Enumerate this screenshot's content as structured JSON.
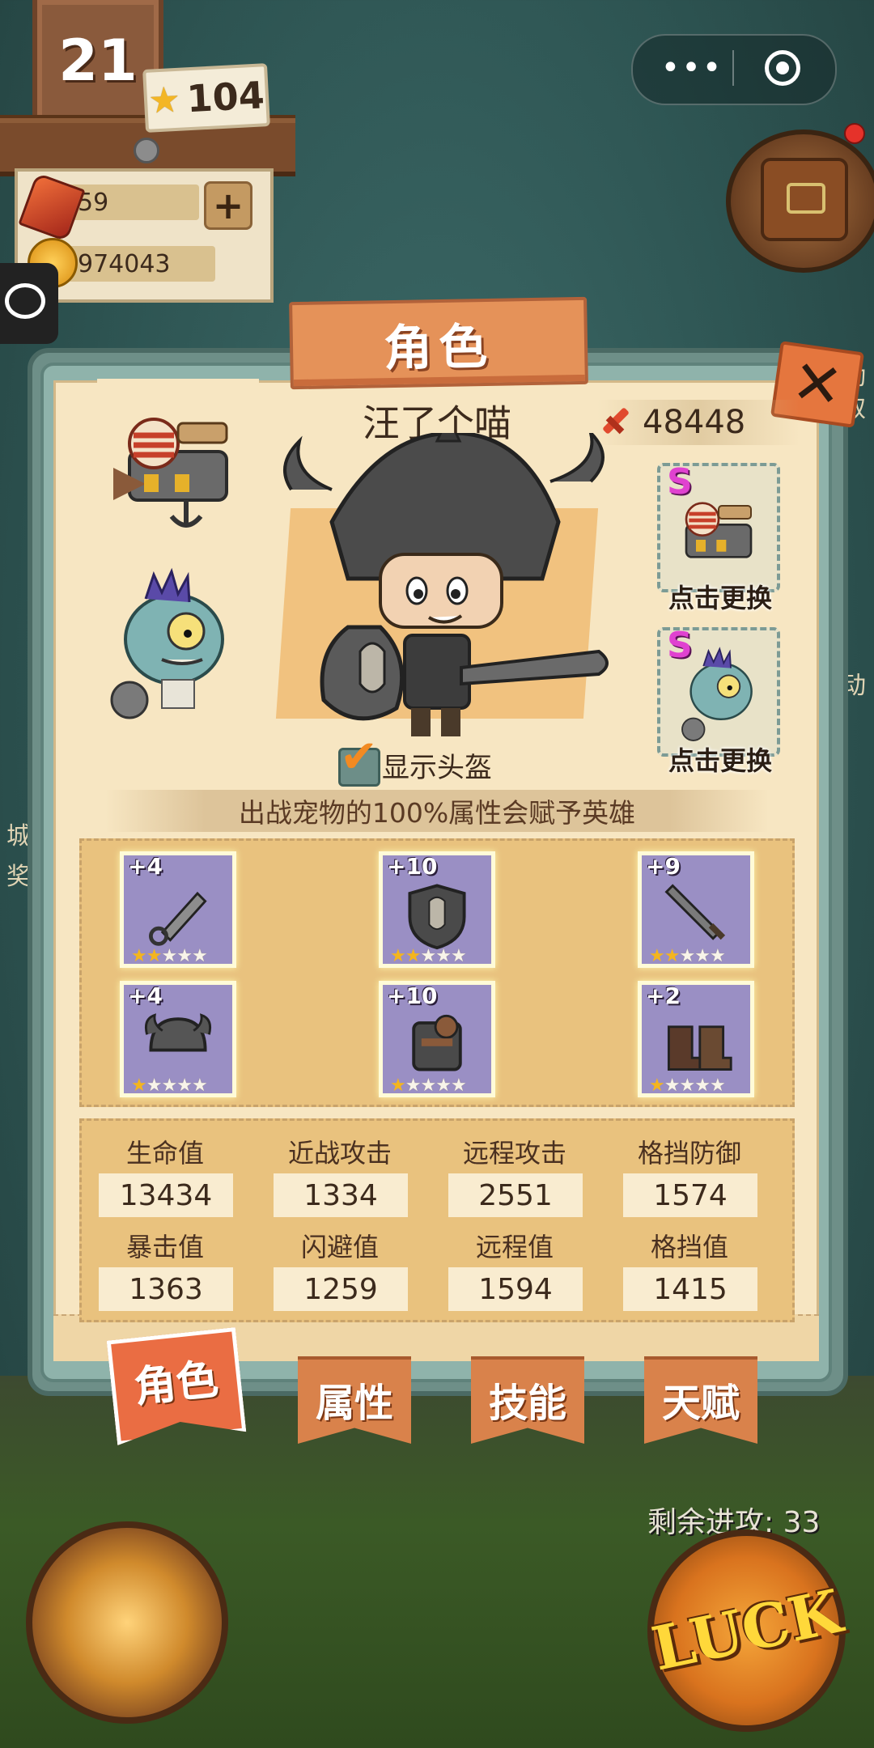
{
  "hud": {
    "level": "21",
    "stars": "104",
    "gems": "59",
    "coins": "974043",
    "add_label": "+"
  },
  "capsule": {
    "more": "•••"
  },
  "panel": {
    "title": "角色",
    "close_label": "✕",
    "hero_name": "汪了个喵",
    "power": "48448",
    "slot_badge": "S",
    "swap_label_1": "点击更换",
    "swap_label_2": "点击更换",
    "helmet_label": "显示头盔",
    "helmet_checked": true,
    "banner": "出战宠物的100%属性会赋予英雄"
  },
  "equipment": [
    {
      "name": "dagger",
      "level": "+4",
      "stars": 2
    },
    {
      "name": "shield",
      "level": "+10",
      "stars": 2
    },
    {
      "name": "sword",
      "level": "+9",
      "stars": 2
    },
    {
      "name": "helmet",
      "level": "+4",
      "stars": 1
    },
    {
      "name": "armor",
      "level": "+10",
      "stars": 1
    },
    {
      "name": "boots",
      "level": "+2",
      "stars": 1
    }
  ],
  "stats": [
    {
      "label": "生命值",
      "value": "13434"
    },
    {
      "label": "近战攻击",
      "value": "1334"
    },
    {
      "label": "远程攻击",
      "value": "2551"
    },
    {
      "label": "格挡防御",
      "value": "1574"
    },
    {
      "label": "暴击值",
      "value": "1363"
    },
    {
      "label": "闪避值",
      "value": "1259"
    },
    {
      "label": "远程值",
      "value": "1594"
    },
    {
      "label": "格挡值",
      "value": "1415"
    }
  ],
  "tabs": [
    {
      "label": "角色",
      "active": true
    },
    {
      "label": "属性",
      "active": false
    },
    {
      "label": "技能",
      "active": false
    },
    {
      "label": "天赋",
      "active": false
    }
  ],
  "side_text": {
    "right_1": "动",
    "right_2": "取",
    "right_3": "动",
    "left_1": "城",
    "left_2": "奖"
  },
  "bottom": {
    "attacks_left": "剩余进攻: 33",
    "luck_label": "LUCK"
  },
  "colors": {
    "title_board": "#e59259",
    "active_tab": "#ea6d43",
    "equip_slot": "#9a8fc4",
    "star_on": "#f4b51e",
    "power_sword": "#e14a2e"
  }
}
